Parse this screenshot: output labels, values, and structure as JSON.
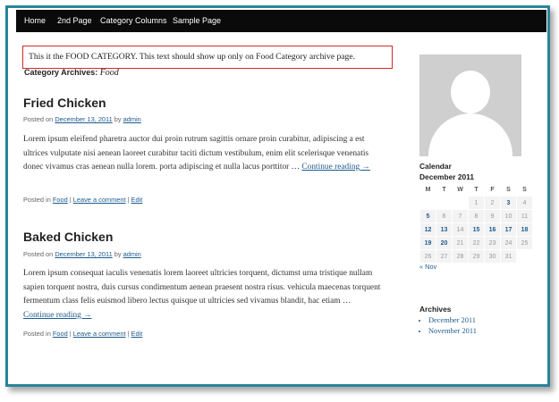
{
  "nav": {
    "items": [
      {
        "label": "Home"
      },
      {
        "label": "2nd Page"
      },
      {
        "label": "Category Columns"
      },
      {
        "label": "Sample Page"
      }
    ]
  },
  "notice": "This it the FOOD CATEGORY. This text should show up only on Food Category archive page.",
  "archive_heading": {
    "prefix": "Category Archives: ",
    "name": "Food"
  },
  "posts": [
    {
      "title": "Fried Chicken",
      "posted_on": "Posted on ",
      "date": "December 13, 2011",
      "by": " by ",
      "author": "admin",
      "excerpt": "Lorem ipsum eleifend pharetra auctor dui proin rutrum sagittis ornare proin curabitur, adipiscing a est ultrices vulputate nisi aenean laoreet curabitur taciti dictum vestibulum, enim elit scelerisque venenatis donec vivamus cras aenean nulla lorem. porta adipiscing et nulla lacus porttitor … ",
      "continue": "Continue reading →",
      "posted_in": "Posted in ",
      "category": "Food",
      "sep": " | ",
      "comment": "Leave a comment",
      "edit": "Edit"
    },
    {
      "title": "Baked Chicken",
      "posted_on": "Posted on ",
      "date": "December 13, 2011",
      "by": " by ",
      "author": "admin",
      "excerpt": "Lorem ipsum consequat iaculis venenatis lorem laoreet ultricies torquent, dictumst urna tristique nullam sapien torquent nostra, duis cursus condimentum aenean praesent nostra risus. vehicula maecenas torquent fermentum class felis euismod libero lectus quisque ut ultricies sed vivamus blandit, hac etiam … ",
      "continue": "Continue reading →",
      "posted_in": "Posted in ",
      "category": "Food",
      "sep": " | ",
      "comment": "Leave a comment",
      "edit": "Edit"
    }
  ],
  "sidebar": {
    "calendar_title": "Calendar",
    "month": "December 2011",
    "weekdays": [
      "M",
      "T",
      "W",
      "T",
      "F",
      "S",
      "S"
    ],
    "weeks": [
      [
        "",
        "",
        "",
        "1",
        "2",
        "3",
        "4"
      ],
      [
        "5",
        "6",
        "7",
        "8",
        "9",
        "10",
        "11"
      ],
      [
        "12",
        "13",
        "14",
        "15",
        "16",
        "17",
        "18"
      ],
      [
        "19",
        "20",
        "21",
        "22",
        "23",
        "24",
        "25"
      ],
      [
        "26",
        "27",
        "28",
        "29",
        "30",
        "31",
        ""
      ]
    ],
    "linked_days": [
      "3",
      "5",
      "12",
      "13",
      "15",
      "16",
      "17",
      "18",
      "19",
      "20"
    ],
    "prev": "« Nov",
    "archives_title": "Archives",
    "archives": [
      "December 2011",
      "November 2011"
    ]
  },
  "colors": {
    "frame": "#2a8399",
    "nav_bg": "#0a0a0a",
    "notice_border": "#d22a2a",
    "link": "#1e5b8d"
  },
  "icons": {
    "avatar": "default-user-avatar-icon"
  }
}
